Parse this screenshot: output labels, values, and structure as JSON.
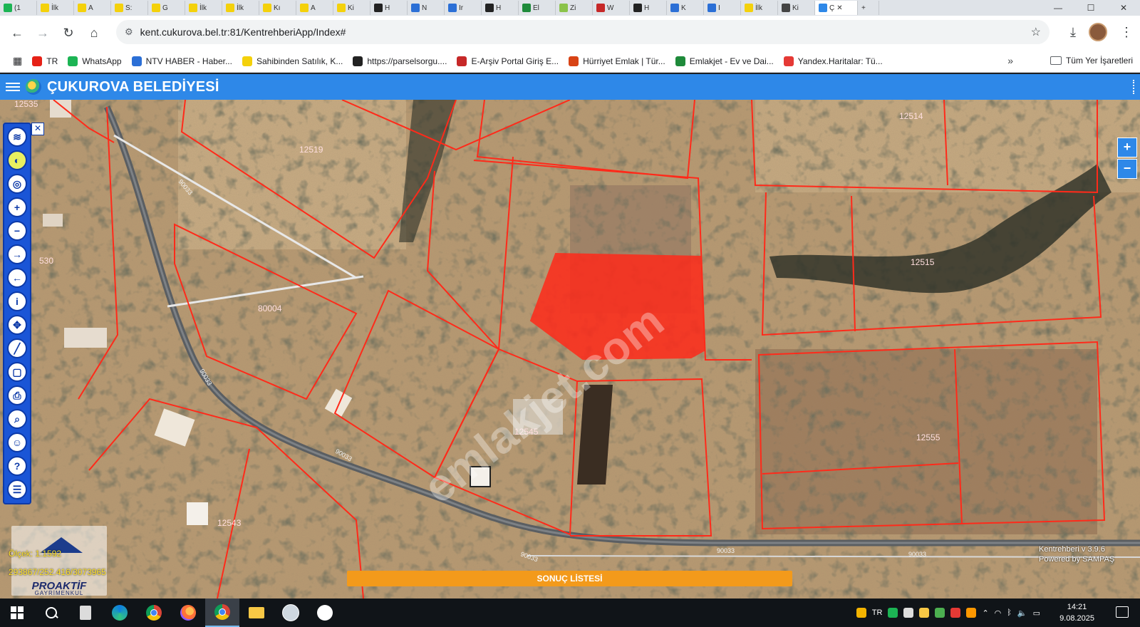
{
  "browser": {
    "tabs": [
      {
        "label": "(1",
        "fav": "#1cb454"
      },
      {
        "label": "İlk",
        "fav": "#f4d10b"
      },
      {
        "label": "A",
        "fav": "#f4d10b"
      },
      {
        "label": "S:",
        "fav": "#f4d10b"
      },
      {
        "label": "G",
        "fav": "#f4d10b"
      },
      {
        "label": "İlk",
        "fav": "#f4d10b"
      },
      {
        "label": "İlk",
        "fav": "#f4d10b"
      },
      {
        "label": "Kı",
        "fav": "#f4d10b"
      },
      {
        "label": "A",
        "fav": "#f4d10b"
      },
      {
        "label": "Ki",
        "fav": "#f4d10b"
      },
      {
        "label": "H",
        "fav": "#222222"
      },
      {
        "label": "N",
        "fav": "#2b6fd6"
      },
      {
        "label": "Ir",
        "fav": "#2b6fd6"
      },
      {
        "label": "H",
        "fav": "#222222"
      },
      {
        "label": "El",
        "fav": "#1e8a3a"
      },
      {
        "label": "Zi",
        "fav": "#8bc34a"
      },
      {
        "label": "W",
        "fav": "#c62828"
      },
      {
        "label": "H",
        "fav": "#222222"
      },
      {
        "label": "K",
        "fav": "#2b6fd6"
      },
      {
        "label": "I",
        "fav": "#2b6fd6"
      },
      {
        "label": "İlk",
        "fav": "#f4d10b"
      },
      {
        "label": "Ki",
        "fav": "#444444"
      }
    ],
    "active_tab": {
      "label": "Ç"
    },
    "window_controls": {
      "minimize": "—",
      "maximize": "☐",
      "close": "✕"
    },
    "url": "kent.cukurova.bel.tr:81/KentrehberiApp/Index#",
    "bookmarks": [
      {
        "label": "TR",
        "color": "#e62117"
      },
      {
        "label": "WhatsApp",
        "color": "#1cb454"
      },
      {
        "label": "NTV HABER - Haber...",
        "color": "#2b6fd6"
      },
      {
        "label": "Sahibinden Satılık, K...",
        "color": "#f4d10b"
      },
      {
        "label": "https://parselsorgu....",
        "color": "#222222"
      },
      {
        "label": "E-Arşiv Portal Giriş E...",
        "color": "#c62828"
      },
      {
        "label": "Hürriyet Emlak | Tür...",
        "color": "#d84315"
      },
      {
        "label": "Emlakjet - Ev ve Dai...",
        "color": "#1e8a3a"
      },
      {
        "label": "Yandex.Haritalar: Tü...",
        "color": "#e53935"
      }
    ],
    "all_bookmarks_label": "Tüm Yer İşaretleri"
  },
  "app": {
    "title": "ÇUKUROVA BELEDİYESİ",
    "version_line1": "Kentrehberi v 3.9.6",
    "version_line2": "Powered by SAMPAŞ",
    "scale_label": "Ölçek: 1:1592",
    "coords": "293867/252.416/3073965",
    "result_bar": "SONUÇ LİSTESİ",
    "zoom_in": "+",
    "zoom_out": "−",
    "watermark": "emlakjet.com"
  },
  "map": {
    "parcel_labels": [
      {
        "text": "12519"
      },
      {
        "text": "12514"
      },
      {
        "text": "12515"
      },
      {
        "text": "80004"
      },
      {
        "text": "12545"
      },
      {
        "text": "12555"
      },
      {
        "text": "12543"
      },
      {
        "text": "12535"
      },
      {
        "text": "530"
      }
    ],
    "road_labels": [
      "90033",
      "90033",
      "90033",
      "90033",
      "90033",
      "90033"
    ],
    "highlight_color": "#ff2a1a",
    "boundary_color": "#ff2a1a"
  },
  "brand": {
    "name": "PROAKTİF",
    "sub": "GAYRİMENKUL"
  },
  "taskbar": {
    "time": "14:21",
    "date": "9.08.2025",
    "tray_lang": "TR"
  }
}
